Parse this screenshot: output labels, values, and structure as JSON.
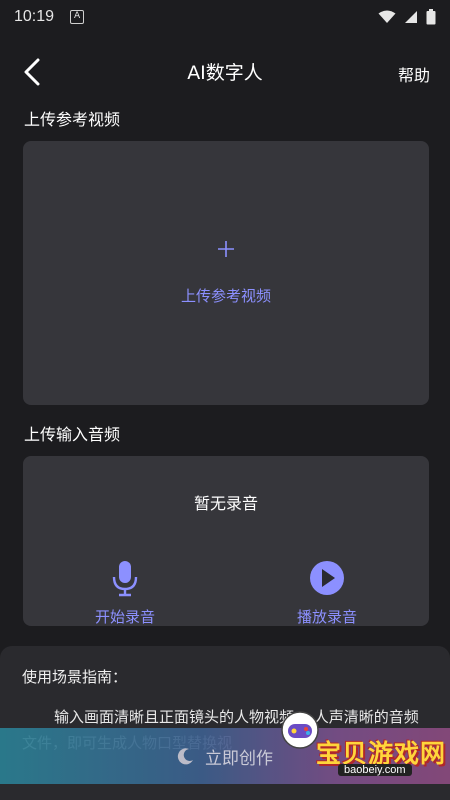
{
  "status_bar": {
    "time": "10:19",
    "notification_icon": "notification-a-icon",
    "icons": [
      "wifi-icon",
      "signal-icon",
      "battery-icon"
    ]
  },
  "header": {
    "back_icon": "chevron-left-icon",
    "title": "AI数字人",
    "help_label": "帮助"
  },
  "video_section": {
    "label": "上传参考视频",
    "upload_icon": "plus-icon",
    "upload_text": "上传参考视频"
  },
  "audio_section": {
    "label": "上传输入音频",
    "empty_text": "暂无录音",
    "record_label": "开始录音",
    "play_label": "播放录音"
  },
  "guide": {
    "title": "使用场景指南：",
    "text": "输入画面清晰且正面镜头的人物视频，      人声清晰的音频文件，即可生成人物口型替换视"
  },
  "create_button": {
    "label": "立即创作",
    "icon": "moon-icon"
  },
  "watermark": {
    "text": "宝贝游戏网",
    "url": "baobeiy.com"
  },
  "colors": {
    "background": "#1c1c1f",
    "card": "#36363b",
    "accent": "#8c90ff"
  }
}
